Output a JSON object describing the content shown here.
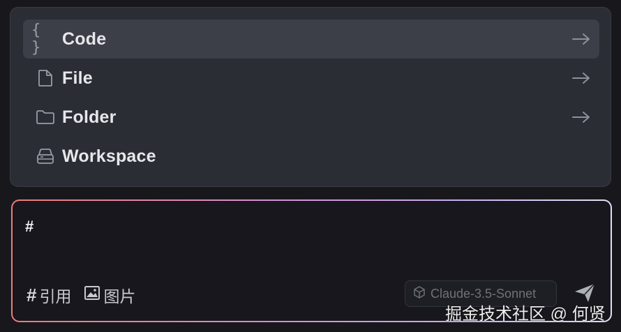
{
  "menu": {
    "items": [
      {
        "label": "Code",
        "icon": "code-braces-icon",
        "has_arrow": true,
        "active": true
      },
      {
        "label": "File",
        "icon": "file-icon",
        "has_arrow": true,
        "active": false
      },
      {
        "label": "Folder",
        "icon": "folder-icon",
        "has_arrow": true,
        "active": false
      },
      {
        "label": "Workspace",
        "icon": "workspace-icon",
        "has_arrow": false,
        "active": false
      }
    ]
  },
  "composer": {
    "input_value": "#",
    "tools": [
      {
        "symbol": "#",
        "label": "引用"
      },
      {
        "icon": "image-icon",
        "label": "图片"
      }
    ],
    "model_label": "Claude-3.5-Sonnet",
    "send_icon": "send-icon"
  },
  "watermark": "掘金技术社区 @ 何贤",
  "colors": {
    "background": "#18181c",
    "menu_bg": "#2b2d35",
    "active_item": "#3c3e48",
    "glow_start": "#f07a7a",
    "glow_end": "#e3e0f5"
  }
}
